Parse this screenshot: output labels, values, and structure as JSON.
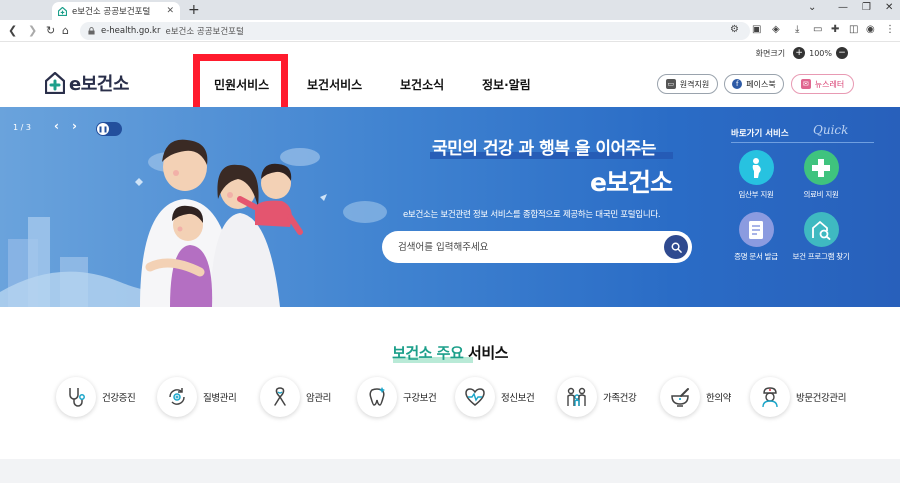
{
  "browser": {
    "tab_title": "e보건소 공공보건포털",
    "tab_close": "✕",
    "new_tab": "+",
    "url": "e-health.go.kr",
    "page_title": "e보건소 공공보건포털"
  },
  "header": {
    "zoom_label": "화면크기",
    "zoom_in": "+",
    "zoom_value": "100%",
    "zoom_out": "−",
    "logo_text": "e보건소",
    "nav": [
      "민원서비스",
      "보건서비스",
      "보건소식",
      "정보·알림"
    ],
    "buttons": {
      "remote": "원격지원",
      "facebook": "페이스북",
      "newsletter": "뉴스레터"
    }
  },
  "hero": {
    "pager": "1 / 3",
    "slogan": "국민의 건강 과 행복 을 이어주는",
    "brand": "e보건소",
    "description": "e보건소는 보건관련 정보 서비스를 종합적으로 제공하는 대국민 포털입니다.",
    "search_placeholder": "검색어를 입력해주세요",
    "quick_title": "바로가기 서비스",
    "quick_sub": "Quick",
    "quick_items": [
      "임산부 지원",
      "의료비 지원",
      "증명 문서 발급",
      "보건 프로그램 찾기"
    ]
  },
  "main": {
    "title_green": "보건소 주요",
    "title_rest": " 서비스",
    "services": [
      "건강증진",
      "질병관리",
      "암관리",
      "구강보건",
      "정신보건",
      "가족건강",
      "한의약",
      "방문건강관리"
    ]
  },
  "colors": {
    "accent_red": "#ff1b2d",
    "hero_blue": "#2a6cc6",
    "brand_green": "#1c9f8a"
  }
}
